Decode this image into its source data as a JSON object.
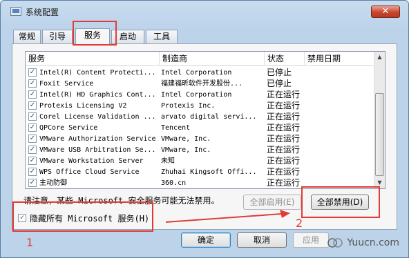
{
  "window": {
    "title": "系统配置",
    "close_glyph": "✕"
  },
  "tabs": [
    {
      "label": "常规"
    },
    {
      "label": "引导"
    },
    {
      "label": "服务"
    },
    {
      "label": "启动"
    },
    {
      "label": "工具"
    }
  ],
  "list": {
    "columns": [
      "服务",
      "制造商",
      "状态",
      "禁用日期"
    ],
    "rows": [
      {
        "checked": true,
        "service": "Intel(R) Content Protecti...",
        "manufacturer": "Intel Corporation",
        "status": "已停止"
      },
      {
        "checked": true,
        "service": "Foxit Service",
        "manufacturer": "福建福昕软件开发股份...",
        "status": "已停止"
      },
      {
        "checked": true,
        "service": "Intel(R) HD Graphics Cont...",
        "manufacturer": "Intel Corporation",
        "status": "正在运行"
      },
      {
        "checked": true,
        "service": "Protexis Licensing V2",
        "manufacturer": "Protexis Inc.",
        "status": "正在运行"
      },
      {
        "checked": true,
        "service": "Corel License Validation ...",
        "manufacturer": "arvato digital servi...",
        "status": "正在运行"
      },
      {
        "checked": true,
        "service": "QPCore Service",
        "manufacturer": "Tencent",
        "status": "正在运行"
      },
      {
        "checked": true,
        "service": "VMware Authorization Service",
        "manufacturer": "VMware, Inc.",
        "status": "正在运行"
      },
      {
        "checked": true,
        "service": "VMware USB Arbitration Se...",
        "manufacturer": "VMware, Inc.",
        "status": "正在运行"
      },
      {
        "checked": true,
        "service": "VMware Workstation Server",
        "manufacturer": "未知",
        "status": "正在运行"
      },
      {
        "checked": true,
        "service": "WPS Office Cloud Service",
        "manufacturer": "Zhuhai Kingsoft Offi...",
        "status": "正在运行"
      },
      {
        "checked": true,
        "service": "主动防御",
        "manufacturer": "360.cn",
        "status": "正在运行"
      }
    ]
  },
  "note": "请注意，某些 Microsoft 安全服务可能无法禁用。",
  "buttons": {
    "enable_all": "全部启用(E)",
    "disable_all": "全部禁用(D)",
    "ok": "确定",
    "cancel": "取消",
    "apply": "应用"
  },
  "hide_ms": {
    "checked": true,
    "label": "隐藏所有 Microsoft 服务(H)"
  },
  "annotations": {
    "num1": "1",
    "num2": "2",
    "color": "#e03b36"
  },
  "watermark": {
    "text": "Yuucn.com"
  }
}
